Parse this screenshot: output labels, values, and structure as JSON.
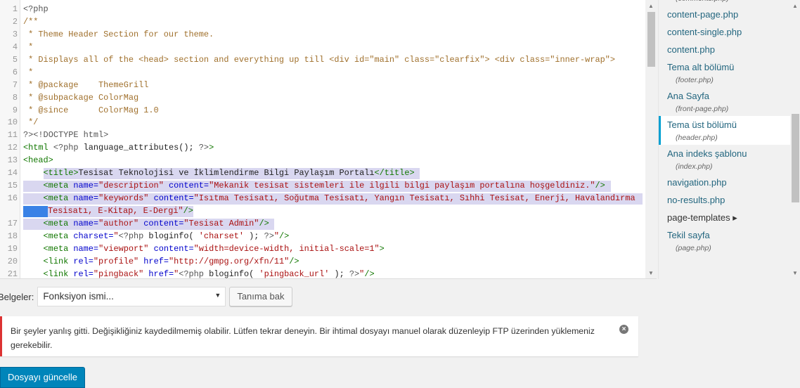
{
  "editor": {
    "lines": [
      {
        "n": "1",
        "tokens": [
          [
            "m",
            "<?php"
          ]
        ]
      },
      {
        "n": "2",
        "tokens": [
          [
            "c",
            "/**"
          ]
        ]
      },
      {
        "n": "3",
        "tokens": [
          [
            "c",
            " * Theme Header Section for our theme."
          ]
        ]
      },
      {
        "n": "4",
        "tokens": [
          [
            "c",
            " *"
          ]
        ]
      },
      {
        "n": "5",
        "tokens": [
          [
            "c",
            " * Displays all of the <head> section and everything up till <div id=\"main\" class=\"clearfix\"> <div class=\"inner-wrap\">"
          ]
        ]
      },
      {
        "n": "6",
        "tokens": [
          [
            "c",
            " *"
          ]
        ]
      },
      {
        "n": "7",
        "tokens": [
          [
            "c",
            " * @package    ThemeGrill"
          ]
        ]
      },
      {
        "n": "8",
        "tokens": [
          [
            "c",
            " * @subpackage ColorMag"
          ]
        ]
      },
      {
        "n": "9",
        "tokens": [
          [
            "c",
            " * @since      ColorMag 1.0"
          ]
        ]
      },
      {
        "n": "10",
        "tokens": [
          [
            "c",
            " */"
          ]
        ]
      },
      {
        "n": "11",
        "tokens": [
          [
            "m",
            "?>"
          ],
          [
            "m",
            "<!DOCTYPE html>"
          ]
        ]
      },
      {
        "n": "12",
        "tokens": [
          [
            "t",
            "<html"
          ],
          [
            "p",
            " "
          ],
          [
            "m",
            "<?php"
          ],
          [
            "p",
            " language_attributes(); "
          ],
          [
            "m",
            "?>"
          ],
          [
            "t",
            ">"
          ]
        ]
      },
      {
        "n": "13",
        "tokens": [
          [
            "t",
            "<head>"
          ]
        ]
      },
      {
        "n": "14",
        "sel": "title",
        "tokens": [
          [
            "p",
            "    "
          ],
          [
            "t",
            "<title>"
          ],
          [
            "p",
            "Tesisat Teknolojisi ve İklimlendirme Bilgi Paylaşım Portalı"
          ],
          [
            "t",
            "</title>"
          ]
        ]
      },
      {
        "n": "15",
        "sel": "full",
        "tokens": [
          [
            "p",
            "    "
          ],
          [
            "t",
            "<meta"
          ],
          [
            "p",
            " "
          ],
          [
            "a",
            "name="
          ],
          [
            "s",
            "\"description\""
          ],
          [
            "p",
            " "
          ],
          [
            "a",
            "content="
          ],
          [
            "s",
            "\"Mekanik tesisat sistemleri ile ilgili bilgi paylaşım portalına hoşgeldiniz.\""
          ],
          [
            "t",
            "/>"
          ]
        ]
      },
      {
        "n": "16",
        "sel": "full",
        "tokens": [
          [
            "p",
            "    "
          ],
          [
            "t",
            "<meta"
          ],
          [
            "p",
            " "
          ],
          [
            "a",
            "name="
          ],
          [
            "s",
            "\"keywords\""
          ],
          [
            "p",
            " "
          ],
          [
            "a",
            "content="
          ],
          [
            "s",
            "\"Isıtma Tesisatı, Soğutma Tesisatı, Yangın Tesisatı, Sıhhi Tesisat, Enerji, Havalandırma"
          ]
        ]
      },
      {
        "n": "",
        "sel": "wrap",
        "tokens": [
          [
            "s",
            "Tesisatı, E-Kitap, E-Dergi\""
          ],
          [
            "t",
            "/>"
          ]
        ]
      },
      {
        "n": "17",
        "sel": "full",
        "tokens": [
          [
            "p",
            "    "
          ],
          [
            "t",
            "<meta"
          ],
          [
            "p",
            " "
          ],
          [
            "a",
            "name="
          ],
          [
            "s",
            "\"author\""
          ],
          [
            "p",
            " "
          ],
          [
            "a",
            "content="
          ],
          [
            "s",
            "\"Tesisat Admin\""
          ],
          [
            "t",
            "/>"
          ]
        ]
      },
      {
        "n": "18",
        "tokens": [
          [
            "p",
            "    "
          ],
          [
            "t",
            "<meta"
          ],
          [
            "p",
            " "
          ],
          [
            "a",
            "charset="
          ],
          [
            "s",
            "\""
          ],
          [
            "m",
            "<?php"
          ],
          [
            "p",
            " bloginfo( "
          ],
          [
            "s",
            "'charset'"
          ],
          [
            "p",
            " ); "
          ],
          [
            "m",
            "?>"
          ],
          [
            "s",
            "\""
          ],
          [
            "t",
            "/>"
          ]
        ]
      },
      {
        "n": "19",
        "tokens": [
          [
            "p",
            "    "
          ],
          [
            "t",
            "<meta"
          ],
          [
            "p",
            " "
          ],
          [
            "a",
            "name="
          ],
          [
            "s",
            "\"viewport\""
          ],
          [
            "p",
            " "
          ],
          [
            "a",
            "content="
          ],
          [
            "s",
            "\"width=device-width, initial-scale=1\""
          ],
          [
            "t",
            ">"
          ]
        ]
      },
      {
        "n": "20",
        "tokens": [
          [
            "p",
            "    "
          ],
          [
            "t",
            "<link"
          ],
          [
            "p",
            " "
          ],
          [
            "a",
            "rel="
          ],
          [
            "s",
            "\"profile\""
          ],
          [
            "p",
            " "
          ],
          [
            "a",
            "href="
          ],
          [
            "s",
            "\"http://gmpg.org/xfn/11\""
          ],
          [
            "t",
            "/>"
          ]
        ]
      },
      {
        "n": "21",
        "tokens": [
          [
            "p",
            "    "
          ],
          [
            "t",
            "<link"
          ],
          [
            "p",
            " "
          ],
          [
            "a",
            "rel="
          ],
          [
            "s",
            "\"pingback\""
          ],
          [
            "p",
            " "
          ],
          [
            "a",
            "href="
          ],
          [
            "s",
            "\""
          ],
          [
            "m",
            "<?php"
          ],
          [
            "p",
            " bloginfo( "
          ],
          [
            "s",
            "'pingback_url'"
          ],
          [
            "p",
            " ); "
          ],
          [
            "m",
            "?>"
          ],
          [
            "s",
            "\""
          ],
          [
            "t",
            "/>"
          ]
        ]
      }
    ]
  },
  "sidebar": {
    "files": [
      {
        "label": "",
        "sub": "(comments.php)"
      },
      {
        "label": "content-page.php"
      },
      {
        "label": "content-single.php"
      },
      {
        "label": "content.php"
      },
      {
        "label": "Tema alt bölümü",
        "sub": "(footer.php)"
      },
      {
        "label": "Ana Sayfa",
        "sub": "(front-page.php)"
      },
      {
        "label": "Tema üst bölümü",
        "sub": "(header.php)",
        "active": true
      },
      {
        "label": "Ana indeks şablonu",
        "sub": "(index.php)"
      },
      {
        "label": "navigation.php"
      },
      {
        "label": "no-results.php"
      },
      {
        "label": "page-templates ▸",
        "folder": true
      },
      {
        "label": "Tekil sayfa",
        "sub": "(page.php)"
      }
    ]
  },
  "docs": {
    "label": "Belgeler:",
    "select_value": "Fonksiyon ismi...",
    "lookup_button": "Tanıma bak"
  },
  "notice": {
    "message": "Bir şeyler yanlış gitti. Değişikliğiniz kaydedilmemiş olabilir. Lütfen tekrar deneyin. Bir ihtimal dosyayı manuel olarak düzenleyip FTP üzerinden yüklemeniz gerekebilir.",
    "close_icon": "×"
  },
  "update_button": "Dosyayı güncelle",
  "colors": {
    "accent": "#0085ba",
    "error": "#dc3232",
    "active_file": "#00a0d2",
    "selection": "#d9d7f0"
  }
}
